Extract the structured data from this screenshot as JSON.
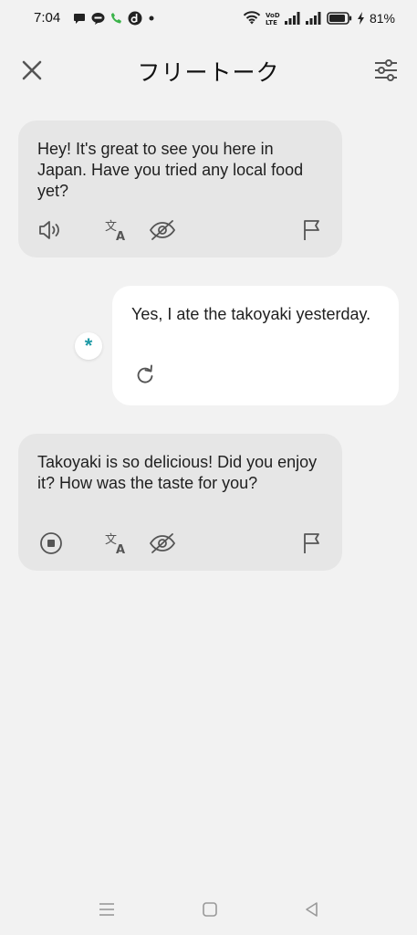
{
  "status_bar": {
    "time": "7:04",
    "battery_percent": "81%",
    "left_icons": [
      "message-icon",
      "line-icon",
      "phone-icon",
      "d-app-icon",
      "dot-icon"
    ],
    "right_icons": [
      "wifi-icon",
      "volte-icon",
      "signal-icon",
      "signal-icon",
      "battery-icon",
      "charging-icon"
    ]
  },
  "header": {
    "title": "フリートーク",
    "close_icon": "close-icon",
    "settings_icon": "sliders-icon"
  },
  "messages": [
    {
      "role": "assistant",
      "text": "Hey! It's great to see you here in Japan. Have you tried any local food yet?",
      "actions": [
        "speaker-icon",
        "translate-icon",
        "eye-off-icon",
        "flag-icon"
      ]
    },
    {
      "role": "user",
      "text": "Yes, I ate the takoyaki yesterday.",
      "actions": [
        "retry-icon"
      ],
      "avatar_glyph": "*"
    },
    {
      "role": "assistant",
      "text": "Takoyaki is so delicious! Did you enjoy it? How was the taste for you?",
      "actions": [
        "stop-icon",
        "translate-icon",
        "eye-off-icon",
        "flag-icon"
      ]
    }
  ],
  "nav_bar": {
    "items": [
      "menu-icon",
      "home-icon",
      "back-icon"
    ]
  },
  "colors": {
    "background": "#f2f2f2",
    "assistant_bubble": "#e6e6e6",
    "user_bubble": "#ffffff",
    "accent": "#1f9aa6",
    "icon_gray": "#555555"
  }
}
